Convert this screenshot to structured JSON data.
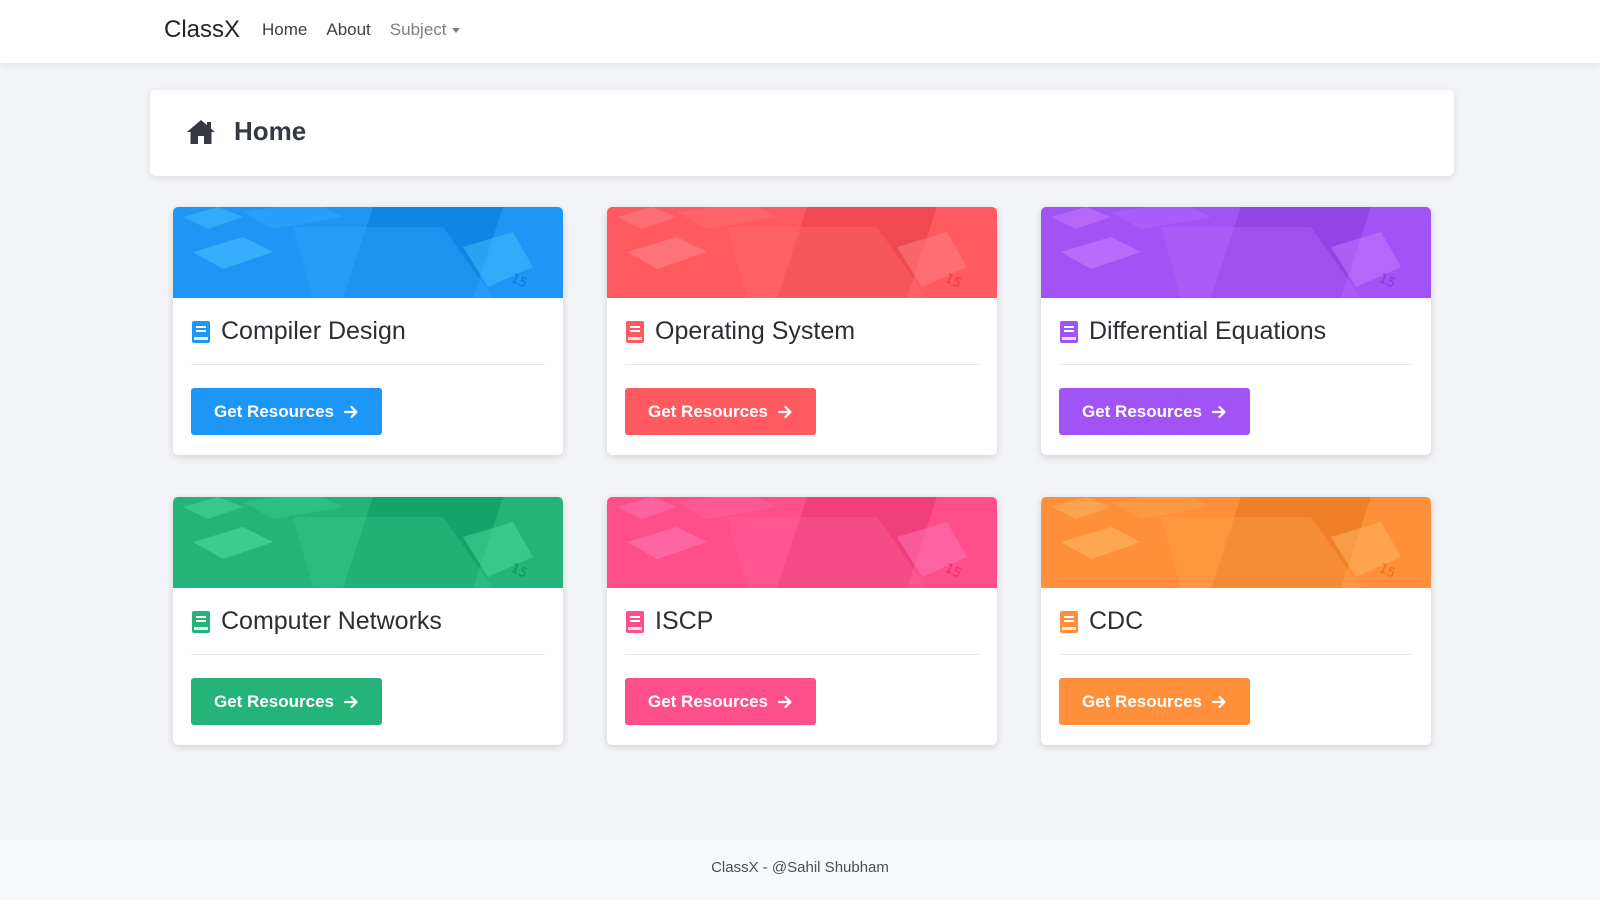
{
  "navbar": {
    "brand": "ClassX",
    "links": [
      {
        "label": "Home"
      },
      {
        "label": "About"
      },
      {
        "label": "Subject"
      }
    ]
  },
  "header": {
    "title": "Home",
    "icon": "home-icon"
  },
  "cards": [
    {
      "title": "Compiler Design",
      "button_label": "Get Resources",
      "color": "#1e96f5",
      "icon": "book-icon"
    },
    {
      "title": "Operating System",
      "button_label": "Get Resources",
      "color": "#ff5a5f",
      "icon": "book-icon"
    },
    {
      "title": "Differential Equations",
      "button_label": "Get Resources",
      "color": "#a253f5",
      "icon": "book-icon"
    },
    {
      "title": "Computer Networks",
      "button_label": "Get Resources",
      "color": "#24b47a",
      "icon": "book-icon"
    },
    {
      "title": "ISCP",
      "button_label": "Get Resources",
      "color": "#ff4f8b",
      "icon": "book-icon"
    },
    {
      "title": "CDC",
      "button_label": "Get Resources",
      "color": "#ff8f3a",
      "icon": "book-icon"
    }
  ],
  "footer": {
    "text": "ClassX - @Sahil Shubham"
  }
}
